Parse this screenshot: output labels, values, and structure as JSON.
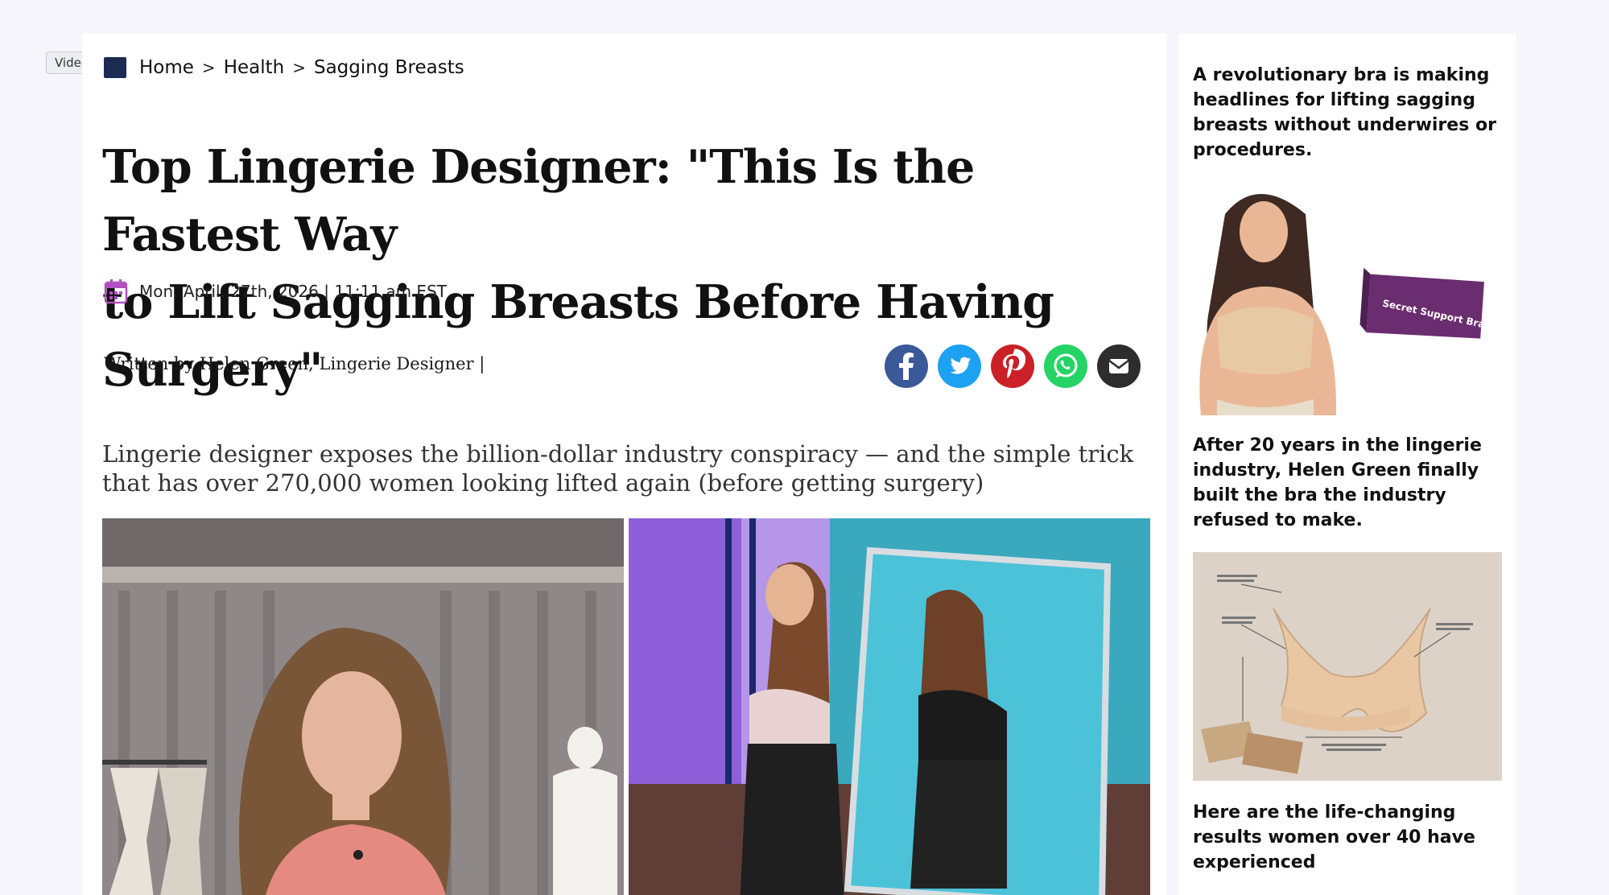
{
  "video_tag": "Video",
  "breadcrumb": {
    "home": "Home",
    "sep": ">",
    "section": "Health",
    "current": "Sagging Breasts"
  },
  "article": {
    "title_line1": "Top Lingerie Designer: \"This Is the Fastest Way",
    "title_line2": "to Lift Sagging Breasts Before Having Surgery\"",
    "dateline": "Mon. April. 27th, 2026 | 11:11 am EST",
    "byline": "Written by Helen Green,  Lingerie Designer |",
    "dek": "Lingerie designer exposes the billion-dollar industry conspiracy — and the simple trick that has over 270,000 women looking lifted again (before getting surgery)"
  },
  "share": {
    "icons": [
      "facebook-icon",
      "twitter-icon",
      "pinterest-icon",
      "whatsapp-icon",
      "email-icon"
    ],
    "colors": {
      "facebook": "#3b5998",
      "twitter": "#1da1f2",
      "pinterest": "#cb2027",
      "whatsapp": "#25d366",
      "email": "#2d2d2d"
    }
  },
  "product": {
    "box_label": "Secret Support Bra"
  },
  "sidebar": {
    "p1": "A revolutionary bra is making headlines for lifting sagging breasts without underwires or procedures.",
    "p2": "After 20 years in the lingerie industry, Helen Green finally built the bra the industry refused to make.",
    "p3": "Here are the life-changing results women over 40 have experienced"
  }
}
